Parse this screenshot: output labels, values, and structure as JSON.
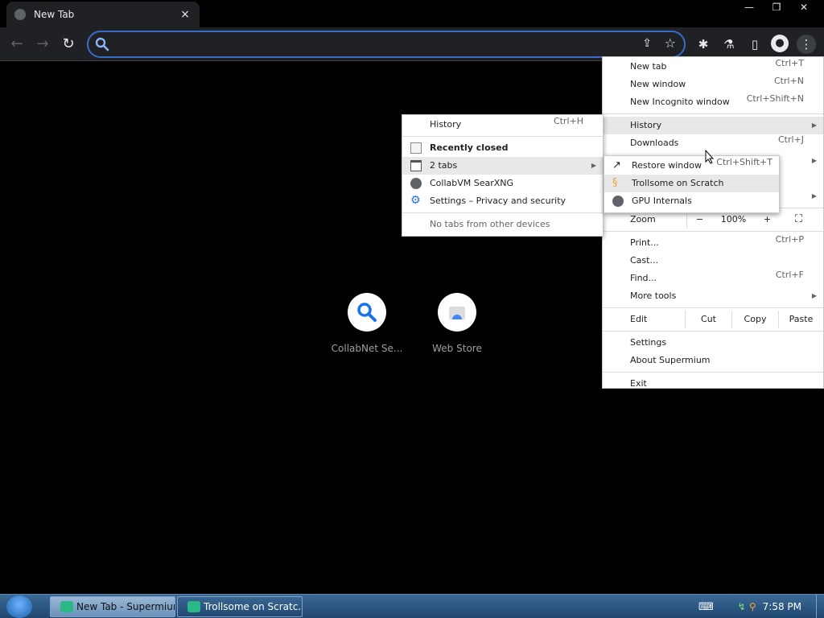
{
  "browser": {
    "tab_title": "New Tab",
    "tab_close": "×",
    "window_controls": [
      "—",
      "❐",
      "✕"
    ],
    "omnibox_value": "",
    "omnibox_placeholder": ""
  },
  "shortcuts": [
    {
      "label": "CollabNet Se..."
    },
    {
      "label": "Web Store"
    }
  ],
  "main_menu": {
    "new_tab": {
      "label": "New tab",
      "shortcut": "Ctrl+T"
    },
    "new_window": {
      "label": "New window",
      "shortcut": "Ctrl+N"
    },
    "new_incognito": {
      "label": "New Incognito window",
      "shortcut": "Ctrl+Shift+N"
    },
    "history": {
      "label": "History"
    },
    "downloads": {
      "label": "Downloads",
      "shortcut": "Ctrl+J"
    },
    "zoom": {
      "label": "Zoom",
      "minus": "−",
      "value": "100%",
      "plus": "+"
    },
    "print": {
      "label": "Print...",
      "shortcut": "Ctrl+P"
    },
    "cast": {
      "label": "Cast..."
    },
    "find": {
      "label": "Find...",
      "shortcut": "Ctrl+F"
    },
    "more_tools": {
      "label": "More tools"
    },
    "edit": {
      "label": "Edit",
      "cut": "Cut",
      "copy": "Copy",
      "paste": "Paste"
    },
    "settings": {
      "label": "Settings"
    },
    "about": {
      "label": "About Supermium"
    },
    "exit": {
      "label": "Exit"
    }
  },
  "history_menu": {
    "history": {
      "label": "History",
      "shortcut": "Ctrl+H"
    },
    "recently_closed": "Recently closed",
    "two_tabs": "2 tabs",
    "collabvm": "CollabVM SearXNG",
    "settings_privacy": "Settings – Privacy and security",
    "no_tabs": "No tabs from other devices"
  },
  "tabs_menu": {
    "restore": {
      "label": "Restore window",
      "shortcut": "Ctrl+Shift+T"
    },
    "trollsome": "Trollsome on Scratch",
    "gpu": "GPU Internals"
  },
  "taskbar": {
    "btn1": "New Tab - Supermium",
    "btn2": "Trollsome on Scratc...",
    "clock": "7:58 PM"
  }
}
